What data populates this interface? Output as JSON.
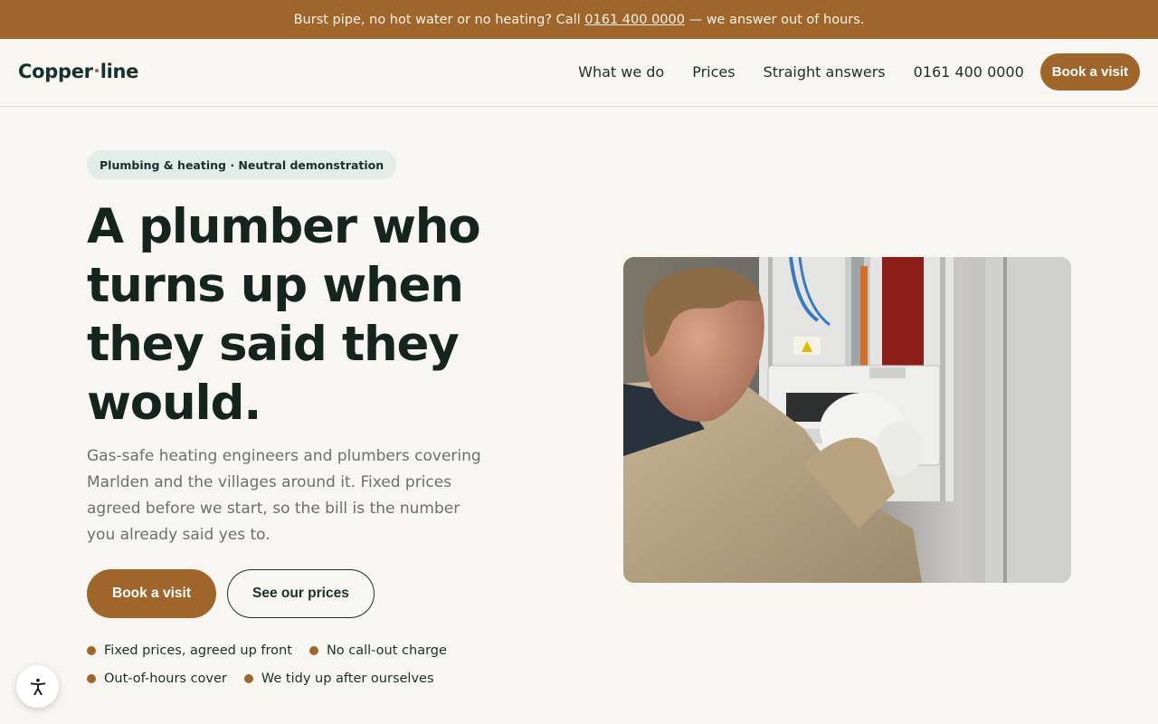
{
  "announcement": {
    "text_before": "Burst pipe, no hot water or no heating? Call ",
    "phone": "0161 400 0000",
    "text_after": " — we answer out of hours."
  },
  "brand": {
    "name_part1": "Copper",
    "name_part2": "line"
  },
  "nav": {
    "links": [
      "What we do",
      "Prices",
      "Straight answers",
      "0161 400 0000"
    ],
    "cta": "Book a visit"
  },
  "hero": {
    "badge": "Plumbing & heating · Neutral demonstration",
    "headline": "A plumber who turns up when they said they would.",
    "lede": "Gas-safe heating engineers and plumbers covering Marlden and the villages around it. Fixed prices agreed before we start, so the bill is the number you already said yes to.",
    "primary_cta": "Book a visit",
    "secondary_cta": "See our prices",
    "features": [
      "Fixed prices, agreed up front",
      "No call-out charge",
      "Out-of-hours cover",
      "We tidy up after ourselves"
    ]
  },
  "colors": {
    "accent": "#a0652b",
    "ink": "#17302e",
    "background": "#f8f6f2",
    "badge_bg": "#e2ede9"
  },
  "icons": {
    "accessibility": "accessibility-person-icon"
  }
}
